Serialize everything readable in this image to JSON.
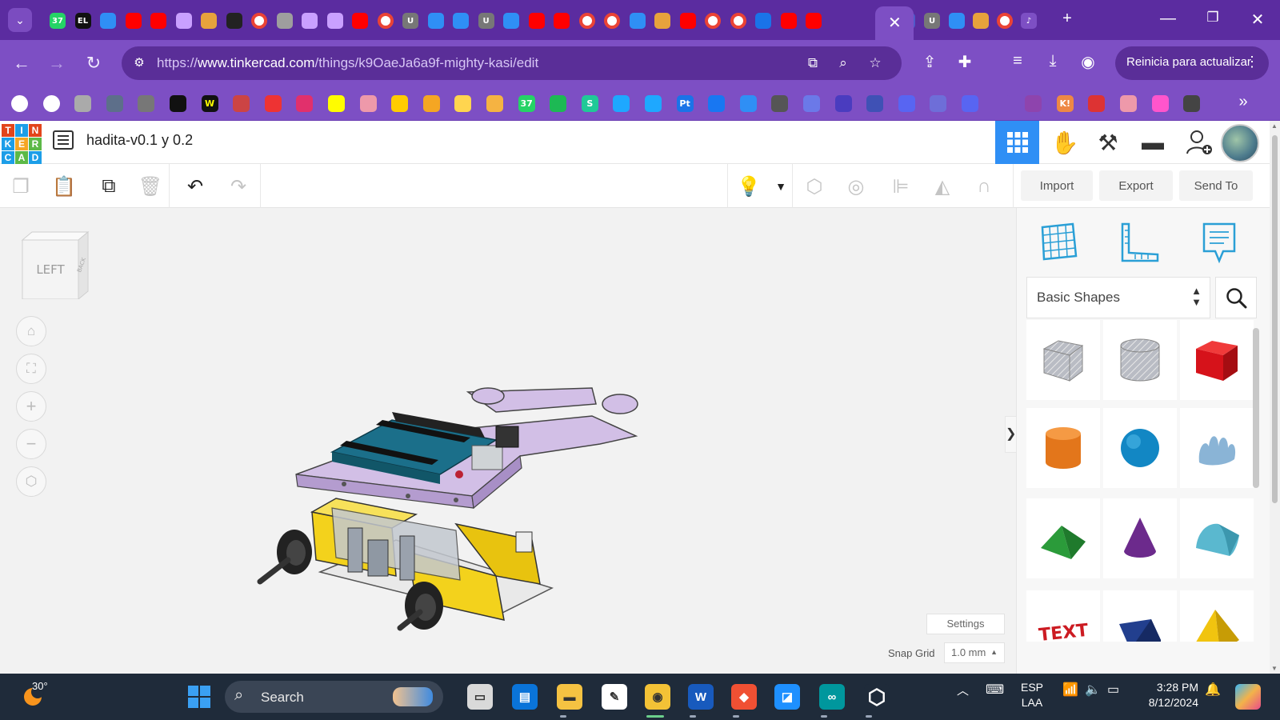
{
  "browser": {
    "url_prefix": "https://",
    "url_domain": "www.tinkercad.com",
    "url_path": "/things/k9OaeJa6a9f-mighty-kasi/edit",
    "update_button": "Reinicia para actualizar",
    "tab_icons": [
      "whatsapp",
      "EL",
      "tinkercad",
      "youtube",
      "youtube",
      "app",
      "collage",
      "github",
      "google",
      "globe",
      "app",
      "app",
      "youtube",
      "google",
      "U",
      "tinkercad",
      "tinkercad",
      "U",
      "tinkercad",
      "youtube",
      "youtube",
      "google",
      "google",
      "tinkercad",
      "collage",
      "youtube",
      "google",
      "google",
      "G",
      "youtube",
      "youtube"
    ],
    "tab_badge": "37",
    "tab_text_el": "EL",
    "tab_text_u": "U",
    "bookmark_text_w": "W",
    "bookmark_text_k": "K!",
    "bookmark_text_pt": "Pt",
    "bookmark_text_37": "37",
    "bookmark_text_s": "S"
  },
  "app": {
    "logo_letters": [
      "T",
      "I",
      "N",
      "K",
      "E",
      "R",
      "C",
      "A",
      "D"
    ],
    "logo_colors": [
      "#e2451b",
      "#1c9ee8",
      "#e2451b",
      "#1c9ee8",
      "#f5a623",
      "#5cb947",
      "#1c9ee8",
      "#5cb947",
      "#1c9ee8"
    ],
    "design_title": "hadita-v0.1 y 0.2",
    "accent": "#2f8ff5"
  },
  "toolbar": {
    "import_label": "Import",
    "export_label": "Export",
    "send_to_label": "Send To"
  },
  "workplane": {
    "viewcube_label": "LEFT",
    "viewcube_side_label": "BACK",
    "settings_label": "Settings",
    "snap_grid_label": "Snap Grid",
    "snap_grid_value": "1.0 mm"
  },
  "shapes_panel": {
    "category": "Basic Shapes",
    "shapes": [
      {
        "name": "Box Hole",
        "color": "#b9bcc4"
      },
      {
        "name": "Cylinder Hole",
        "color": "#b9bcc4"
      },
      {
        "name": "Box",
        "color": "#d6121a"
      },
      {
        "name": "Cylinder",
        "color": "#e3761b"
      },
      {
        "name": "Sphere",
        "color": "#1287c4"
      },
      {
        "name": "Scribble",
        "color": "#8ab4d6"
      },
      {
        "name": "Roof",
        "color": "#2b9b3a"
      },
      {
        "name": "Cone",
        "color": "#6c2a8c"
      },
      {
        "name": "Round Roof",
        "color": "#5ab8cf"
      },
      {
        "name": "Text",
        "color": "#cc1b22"
      },
      {
        "name": "Wedge",
        "color": "#223f8e"
      },
      {
        "name": "Pyramid",
        "color": "#f1c40f"
      }
    ]
  },
  "taskbar": {
    "temperature": "30°",
    "search_placeholder": "Search",
    "language_top": "ESP",
    "language_bottom": "LAA",
    "time": "3:28 PM",
    "date": "8/12/2024"
  }
}
